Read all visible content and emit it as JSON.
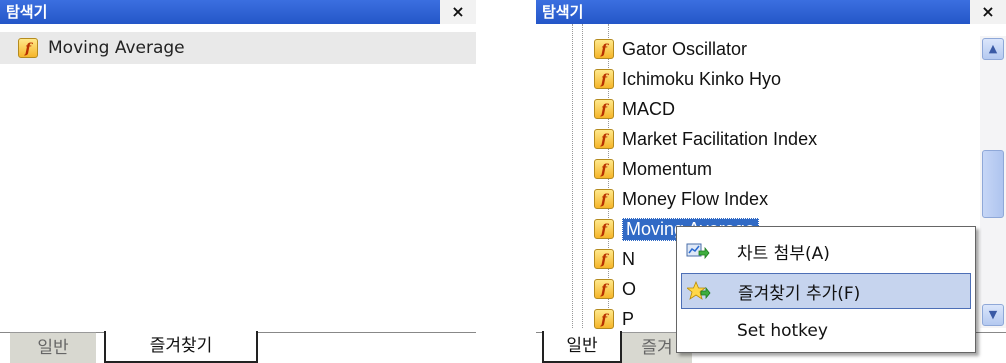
{
  "left_panel": {
    "title": "탐색기",
    "close_label": "×",
    "items": [
      {
        "label": "Moving Average",
        "icon": "function-icon"
      }
    ],
    "tabs": [
      {
        "label": "일반",
        "active": false
      },
      {
        "label": "즐겨찾기",
        "active": true
      }
    ]
  },
  "right_panel": {
    "title": "탐색기",
    "close_label": "×",
    "tree_items": [
      {
        "label": "Gator Oscillator"
      },
      {
        "label": "Ichimoku Kinko Hyo"
      },
      {
        "label": "MACD"
      },
      {
        "label": "Market Facilitation Index"
      },
      {
        "label": "Momentum"
      },
      {
        "label": "Money Flow Index"
      },
      {
        "label": "Moving Average",
        "selected": true
      },
      {
        "label": "N"
      },
      {
        "label": "O"
      },
      {
        "label": "P"
      }
    ],
    "tabs": [
      {
        "label": "일반",
        "active": true
      },
      {
        "label": "즐겨",
        "active": false
      }
    ]
  },
  "context_menu": {
    "items": [
      {
        "label": "차트 첨부(A)",
        "icon": "chart-attach-icon"
      },
      {
        "label": "즐겨찾기 추가(F)",
        "icon": "add-favorite-icon",
        "highlighted": true
      },
      {
        "label": "Set hotkey",
        "icon": ""
      }
    ]
  },
  "colors": {
    "titlebar": "#2f63d6",
    "selection": "#316ac5",
    "menu_highlight": "#c6d4ee"
  }
}
